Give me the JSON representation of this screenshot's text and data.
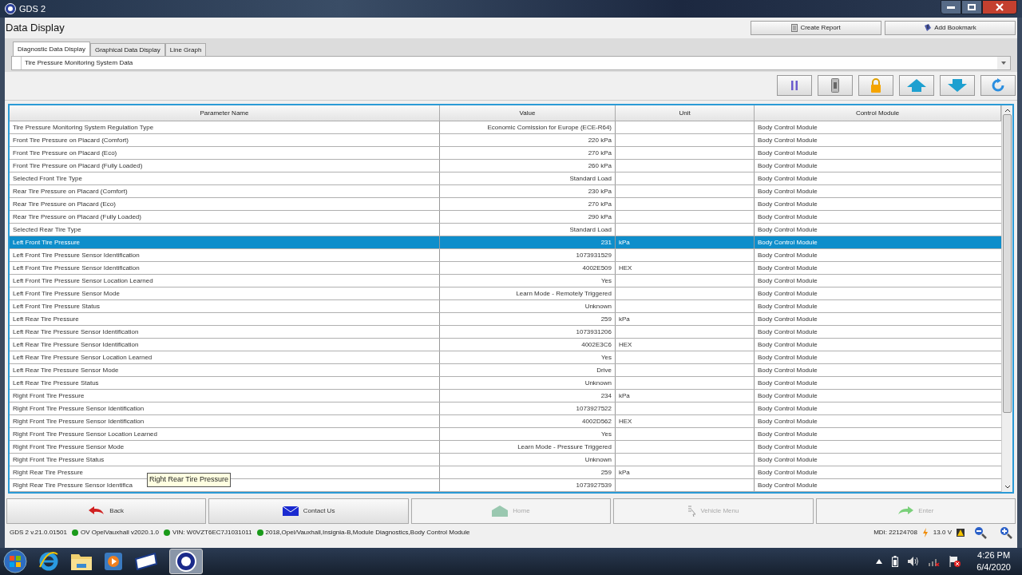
{
  "window": {
    "title": "GDS 2"
  },
  "page_title": "Data Display",
  "header_buttons": [
    "Create Report",
    "Add Bookmark"
  ],
  "tabs": [
    {
      "label": "Diagnostic Data Display",
      "selected": true
    },
    {
      "label": "Graphical Data Display",
      "selected": false
    },
    {
      "label": "Line Graph",
      "selected": false
    }
  ],
  "data_list": {
    "value": "Tire Pressure Monitoring System Data"
  },
  "table": {
    "columns": [
      "Parameter Name",
      "Value",
      "Unit",
      "Control Module"
    ],
    "rows": [
      {
        "cells": [
          "Tire Pressure Monitoring System Regulation Type",
          "Economic Comission for Europe (ECE-R64)",
          "",
          "Body Control Module"
        ],
        "selected": false
      },
      {
        "cells": [
          "Front Tire Pressure on Placard (Comfort)",
          "220 kPa",
          "",
          "Body Control Module"
        ],
        "selected": false
      },
      {
        "cells": [
          "Front Tire Pressure on Placard (Eco)",
          "270 kPa",
          "",
          "Body Control Module"
        ],
        "selected": false
      },
      {
        "cells": [
          "Front Tire Pressure on Placard (Fully Loaded)",
          "260 kPa",
          "",
          "Body Control Module"
        ],
        "selected": false
      },
      {
        "cells": [
          "Selected Front Tire Type",
          "Standard Load",
          "",
          "Body Control Module"
        ],
        "selected": false
      },
      {
        "cells": [
          "Rear Tire Pressure on Placard (Comfort)",
          "230 kPa",
          "",
          "Body Control Module"
        ],
        "selected": false
      },
      {
        "cells": [
          "Rear Tire Pressure on Placard (Eco)",
          "270 kPa",
          "",
          "Body Control Module"
        ],
        "selected": false
      },
      {
        "cells": [
          "Rear Tire Pressure on Placard (Fully Loaded)",
          "290 kPa",
          "",
          "Body Control Module"
        ],
        "selected": false
      },
      {
        "cells": [
          "Selected Rear Tire Type",
          "Standard Load",
          "",
          "Body Control Module"
        ],
        "selected": false
      },
      {
        "cells": [
          "Left Front Tire Pressure",
          "231",
          "kPa",
          "Body Control Module"
        ],
        "selected": true
      },
      {
        "cells": [
          "Left Front Tire Pressure Sensor Identification",
          "1073931529",
          "",
          "Body Control Module"
        ],
        "selected": false
      },
      {
        "cells": [
          "Left Front Tire Pressure Sensor Identification",
          "4002E509",
          "HEX",
          "Body Control Module"
        ],
        "selected": false
      },
      {
        "cells": [
          "Left Front Tire Pressure Sensor Location Learned",
          "Yes",
          "",
          "Body Control Module"
        ],
        "selected": false
      },
      {
        "cells": [
          "Left Front Tire Pressure Sensor Mode",
          "Learn Mode - Remotely Triggered",
          "",
          "Body Control Module"
        ],
        "selected": false
      },
      {
        "cells": [
          "Left Front Tire Pressure Status",
          "Unknown",
          "",
          "Body Control Module"
        ],
        "selected": false
      },
      {
        "cells": [
          "Left Rear Tire Pressure",
          "259",
          "kPa",
          "Body Control Module"
        ],
        "selected": false
      },
      {
        "cells": [
          "Left Rear Tire Pressure Sensor Identification",
          "1073931206",
          "",
          "Body Control Module"
        ],
        "selected": false
      },
      {
        "cells": [
          "Left Rear Tire Pressure Sensor Identification",
          "4002E3C6",
          "HEX",
          "Body Control Module"
        ],
        "selected": false
      },
      {
        "cells": [
          "Left Rear Tire Pressure Sensor Location Learned",
          "Yes",
          "",
          "Body Control Module"
        ],
        "selected": false
      },
      {
        "cells": [
          "Left Rear Tire Pressure Sensor Mode",
          "Drive",
          "",
          "Body Control Module"
        ],
        "selected": false
      },
      {
        "cells": [
          "Left Rear Tire Pressure Status",
          "Unknown",
          "",
          "Body Control Module"
        ],
        "selected": false
      },
      {
        "cells": [
          "Right Front Tire Pressure",
          "234",
          "kPa",
          "Body Control Module"
        ],
        "selected": false
      },
      {
        "cells": [
          "Right Front Tire Pressure Sensor Identification",
          "1073927522",
          "",
          "Body Control Module"
        ],
        "selected": false
      },
      {
        "cells": [
          "Right Front Tire Pressure Sensor Identification",
          "4002D562",
          "HEX",
          "Body Control Module"
        ],
        "selected": false
      },
      {
        "cells": [
          "Right Front Tire Pressure Sensor Location Learned",
          "Yes",
          "",
          "Body Control Module"
        ],
        "selected": false
      },
      {
        "cells": [
          "Right Front Tire Pressure Sensor Mode",
          "Learn Mode - Pressure Triggered",
          "",
          "Body Control Module"
        ],
        "selected": false
      },
      {
        "cells": [
          "Right Front Tire Pressure Status",
          "Unknown",
          "",
          "Body Control Module"
        ],
        "selected": false
      },
      {
        "cells": [
          "Right Rear Tire Pressure",
          "259",
          "kPa",
          "Body Control Module"
        ],
        "selected": false
      },
      {
        "cells": [
          "Right Rear Tire Pressure Sensor Identifica",
          "1073927539",
          "",
          "Body Control Module"
        ],
        "selected": false
      }
    ]
  },
  "tooltip": "Right Rear Tire Pressure",
  "nav_buttons": [
    {
      "kind": "back",
      "label": "Back",
      "disabled": false
    },
    {
      "kind": "contact",
      "label": "Contact Us",
      "disabled": false
    },
    {
      "kind": "home",
      "label": "Home",
      "disabled": true
    },
    {
      "kind": "vehicle",
      "label": "Vehicle Menu",
      "disabled": true
    },
    {
      "kind": "enter",
      "label": "Enter",
      "disabled": true
    }
  ],
  "status_bar": {
    "version": "GDS 2 v.21.0.01501",
    "items": [
      {
        "text": "OV OpelVauxhall v2020.1.0",
        "color": "#1a9a1a"
      },
      {
        "text": "VIN: W0VZT6EC7J1031011",
        "color": "#1a9a1a"
      },
      {
        "text": "2018,Opel/Vauxhall,Insignia-B,Module Diagnostics,Body Control Module",
        "color": "#1a9a1a"
      }
    ],
    "mdi": "MDI: 22124708",
    "voltage": "13.0 V"
  },
  "taskbar": {
    "time": "4:26 PM",
    "date": "6/4/2020"
  }
}
